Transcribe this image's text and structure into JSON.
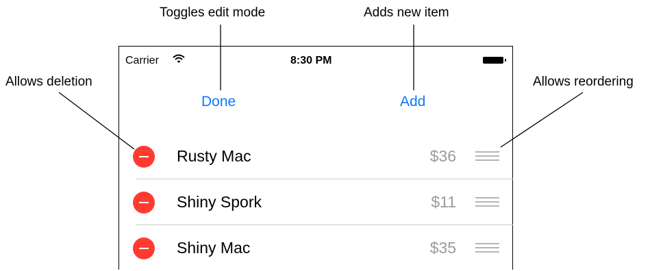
{
  "callouts": {
    "edit_mode": "Toggles edit mode",
    "add_item": "Adds new item",
    "deletion": "Allows deletion",
    "reordering": "Allows reordering"
  },
  "status_bar": {
    "carrier": "Carrier",
    "time": "8:30 PM",
    "wifi_icon": "wifi-icon",
    "battery_icon": "battery-icon"
  },
  "nav": {
    "done_label": "Done",
    "add_label": "Add"
  },
  "items": [
    {
      "name": "Rusty Mac",
      "price": "$36"
    },
    {
      "name": "Shiny Spork",
      "price": "$11"
    },
    {
      "name": "Shiny Mac",
      "price": "$35"
    }
  ],
  "colors": {
    "tint": "#0a7aff",
    "delete": "#ff3b30",
    "price": "#9b9b9b"
  }
}
